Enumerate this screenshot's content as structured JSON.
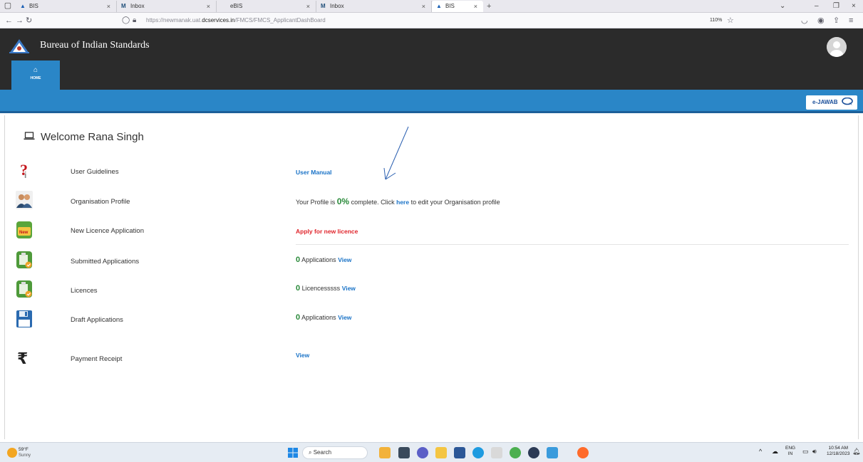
{
  "browser": {
    "tabs": [
      {
        "label": "BIS",
        "icon": "bis-favicon",
        "active": false
      },
      {
        "label": "Inbox",
        "icon": "gmail-favicon",
        "active": false
      },
      {
        "label": "eBIS",
        "icon": "bis-favicon",
        "active": false
      },
      {
        "label": "Inbox",
        "icon": "gmail-favicon",
        "active": false
      },
      {
        "label": "BIS",
        "icon": "bis-favicon",
        "active": true
      }
    ],
    "url_prefix": "https://newmanak.uat.",
    "url_domain": "dcservices.in",
    "url_path": "/FMCS/FMCS_ApplicantDashBoard",
    "zoom": "110%"
  },
  "site": {
    "title": "Bureau of Indian Standards",
    "home_label": "HOME",
    "ejawab_label": "e-JAWAB"
  },
  "dashboard": {
    "welcome": "Welcome Rana Singh",
    "rows": {
      "guidelines": {
        "label": "User Guidelines",
        "link": "User Manual"
      },
      "profile": {
        "label": "Organisation Profile",
        "prefix": "Your Profile is",
        "percent": "0%",
        "mid": "complete. Click",
        "link": "here",
        "suffix": "to edit your Organisation profile"
      },
      "new_licence": {
        "label": "New Licence Application",
        "link": "Apply for new licence"
      },
      "submitted": {
        "label": "Submitted Applications",
        "count": "0",
        "unit": "Applications",
        "link": "View"
      },
      "licences": {
        "label": "Licences",
        "count": "0",
        "unit": "Licencesssss",
        "link": "View"
      },
      "drafts": {
        "label": "Draft Applications",
        "count": "0",
        "unit": "Applications",
        "link": "View"
      },
      "payment": {
        "label": "Payment Receipt",
        "link": "View"
      }
    }
  },
  "taskbar": {
    "temperature": "59°F",
    "condition": "Sunny",
    "search_label": "Search",
    "lang_top": "ENG",
    "lang_bottom": "IN",
    "time": "10:54 AM",
    "date": "12/18/2023"
  },
  "colors": {
    "header_dark": "#2b2b2b",
    "brand_blue": "#2a86c7",
    "link_blue": "#1a73c7",
    "link_red": "#e0242b",
    "count_green": "#2a8a3a"
  }
}
